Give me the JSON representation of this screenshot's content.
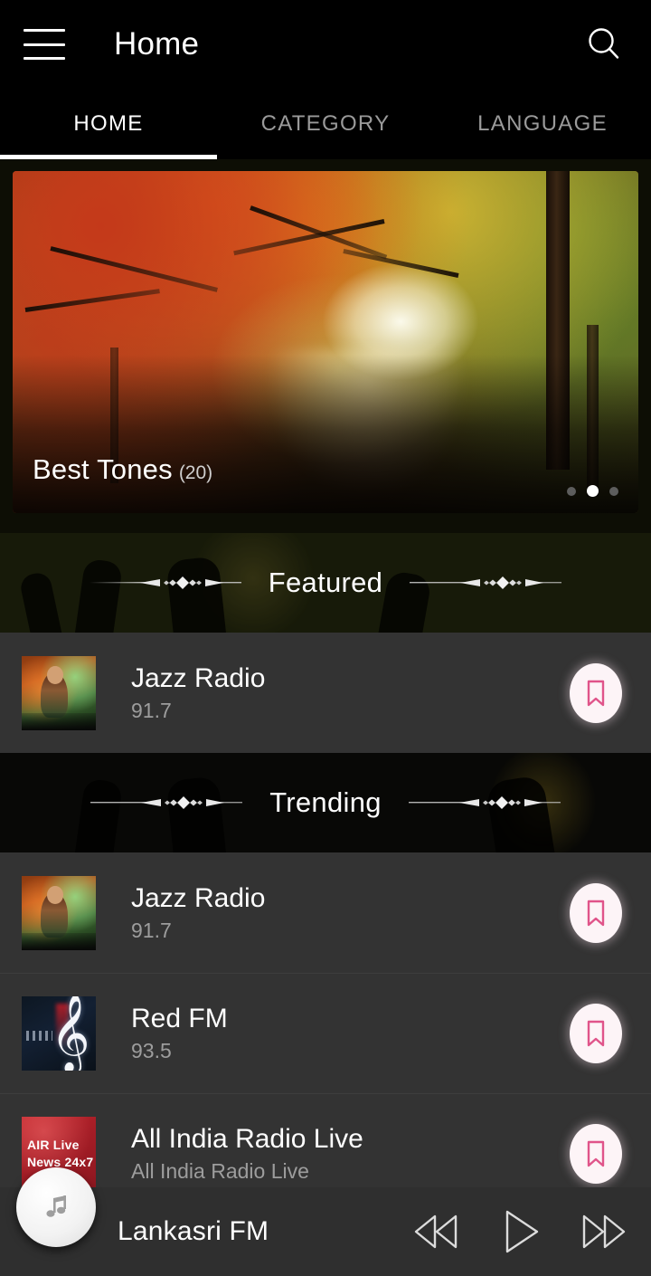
{
  "appbar": {
    "menu_icon": "hamburger-menu-icon",
    "title": "Home",
    "search_icon": "search-icon"
  },
  "tabs": [
    {
      "label": "HOME",
      "active": true
    },
    {
      "label": "CATEGORY",
      "active": false
    },
    {
      "label": "LANGUAGE",
      "active": false
    }
  ],
  "banner": {
    "title": "Best Tones",
    "count": "(20)",
    "image_description": "autumn forest path with red and orange foliage",
    "dots": [
      {
        "active": false
      },
      {
        "active": true
      },
      {
        "active": false
      }
    ]
  },
  "sections": [
    {
      "title": "Featured",
      "ornament_icon": "diamond-divider-icon",
      "items": [
        {
          "name": "Jazz Radio",
          "frequency": "91.7",
          "artwork": "dj-woman-headphones-thumbnail",
          "bookmark_icon": "bookmark-icon"
        }
      ]
    },
    {
      "title": "Trending",
      "ornament_icon": "diamond-divider-icon",
      "items": [
        {
          "name": "Jazz Radio",
          "frequency": "91.7",
          "artwork": "dj-woman-headphones-thumbnail",
          "bookmark_icon": "bookmark-icon"
        },
        {
          "name": "Red FM",
          "frequency": "93.5",
          "artwork": "treble-clef-thumbnail",
          "bookmark_icon": "bookmark-icon"
        },
        {
          "name": "All India Radio Live",
          "frequency": "All India Radio Live",
          "artwork": "air-live-red-thumbnail",
          "artwork_line1": "AIR Live",
          "artwork_line2": "News 24x7",
          "bookmark_icon": "bookmark-icon"
        }
      ]
    }
  ],
  "player": {
    "station": "Lankasri FM",
    "art_icon": "music-note-icon",
    "previous_icon": "rewind-icon",
    "play_icon": "play-icon",
    "next_icon": "fast-forward-icon"
  },
  "colors": {
    "accent_pink": "#e0548a",
    "row_background": "#333333",
    "player_background": "#2f2f2f",
    "appbar_background": "#000000"
  }
}
